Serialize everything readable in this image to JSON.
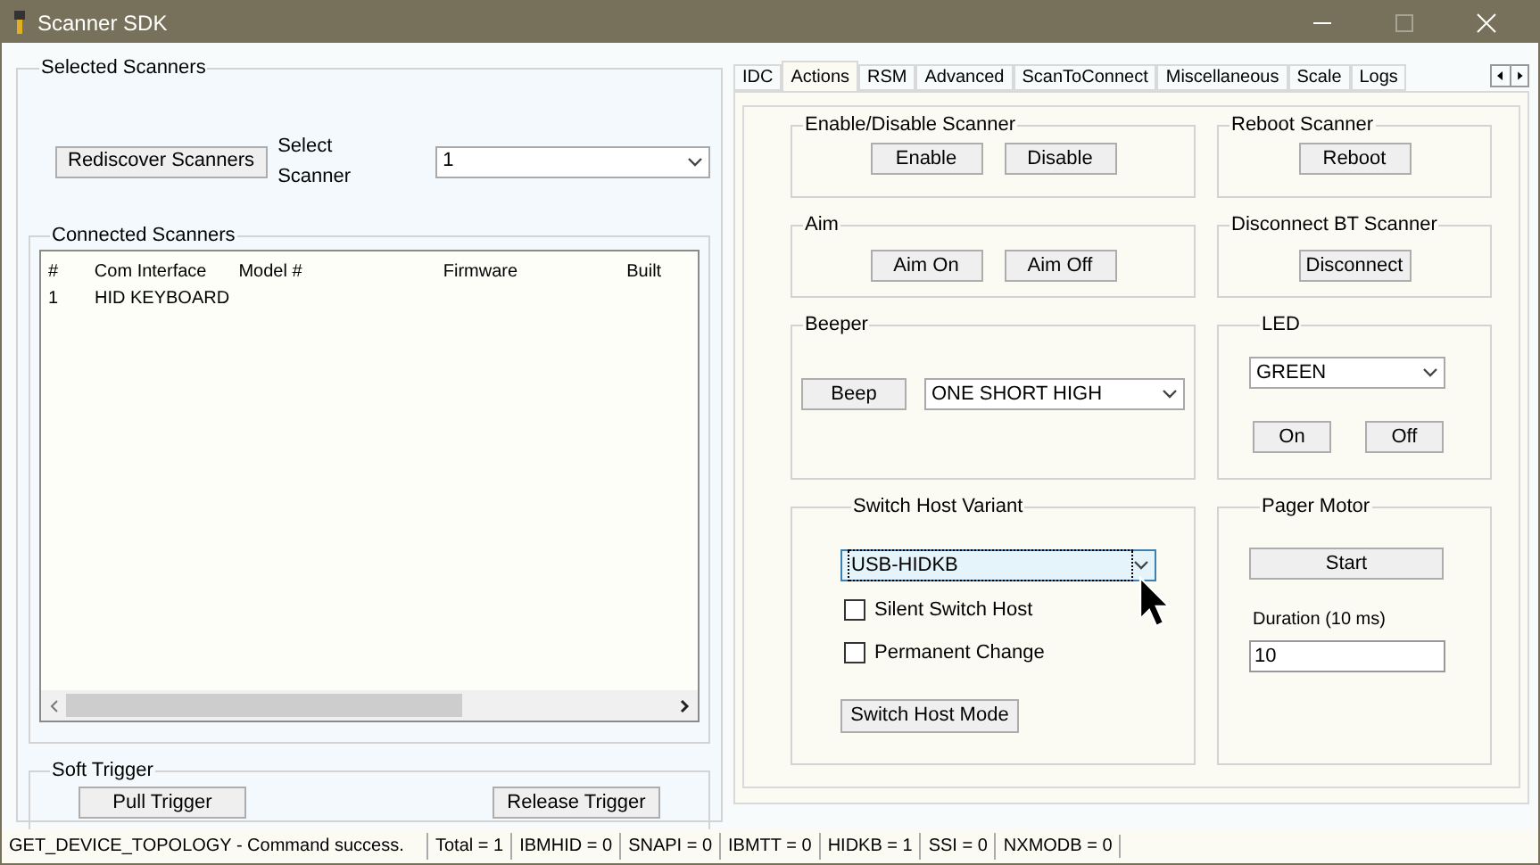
{
  "window": {
    "title": "Scanner SDK"
  },
  "selected_scanners": {
    "title": "Selected Scanners",
    "rediscover_button": "Rediscover Scanners",
    "select_label": "Select Scanner",
    "select_value": "1"
  },
  "connected_scanners": {
    "title": "Connected Scanners",
    "columns": [
      "#",
      "Com Interface",
      "Model #",
      "Firmware",
      "Built"
    ],
    "rows": [
      {
        "number": "1",
        "com_interface": "HID KEYBOARD"
      }
    ]
  },
  "soft_trigger": {
    "title": "Soft Trigger",
    "buttons": [
      "Pull Trigger",
      "Release Trigger"
    ]
  },
  "tabs": [
    {
      "label": "IDC",
      "selected": false
    },
    {
      "label": "Actions",
      "selected": true
    },
    {
      "label": "RSM",
      "selected": false
    },
    {
      "label": "Advanced",
      "selected": false
    },
    {
      "label": "ScanToConnect",
      "selected": false
    },
    {
      "label": "Miscellaneous",
      "selected": false
    },
    {
      "label": "Scale",
      "selected": false
    },
    {
      "label": "Logs",
      "selected": false
    }
  ],
  "actions": {
    "enable_disable": {
      "title": "Enable/Disable Scanner",
      "buttons": [
        "Enable",
        "Disable"
      ]
    },
    "reboot": {
      "title": "Reboot Scanner",
      "button": "Reboot"
    },
    "aim": {
      "title": "Aim",
      "buttons": [
        "Aim On",
        "Aim Off"
      ]
    },
    "disconnect": {
      "title": "Disconnect BT Scanner",
      "button": "Disconnect"
    },
    "beeper": {
      "title": "Beeper",
      "button": "Beep",
      "select_value": "ONE SHORT HIGH"
    },
    "led": {
      "title": "LED",
      "select_value": "GREEN",
      "buttons": [
        "On",
        "Off"
      ]
    },
    "switch_host": {
      "title": "Switch Host Variant",
      "select_value": "USB-HIDKB",
      "focused": true,
      "checkboxes": [
        {
          "label": "Silent Switch Host",
          "checked": false
        },
        {
          "label": "Permanent Change",
          "checked": false
        }
      ],
      "button": "Switch Host Mode"
    },
    "pager_motor": {
      "title": "Pager Motor",
      "button": "Start",
      "duration_label": "Duration (10 ms)",
      "duration_value": "10"
    }
  },
  "status_bar": {
    "message": "GET_DEVICE_TOPOLOGY - Command success.",
    "counts": [
      "Total = 1",
      "IBMHID = 0",
      "SNAPI = 0",
      "IBMTT = 0",
      "HIDKB = 1",
      "SSI = 0",
      "NXMODB = 0"
    ]
  }
}
